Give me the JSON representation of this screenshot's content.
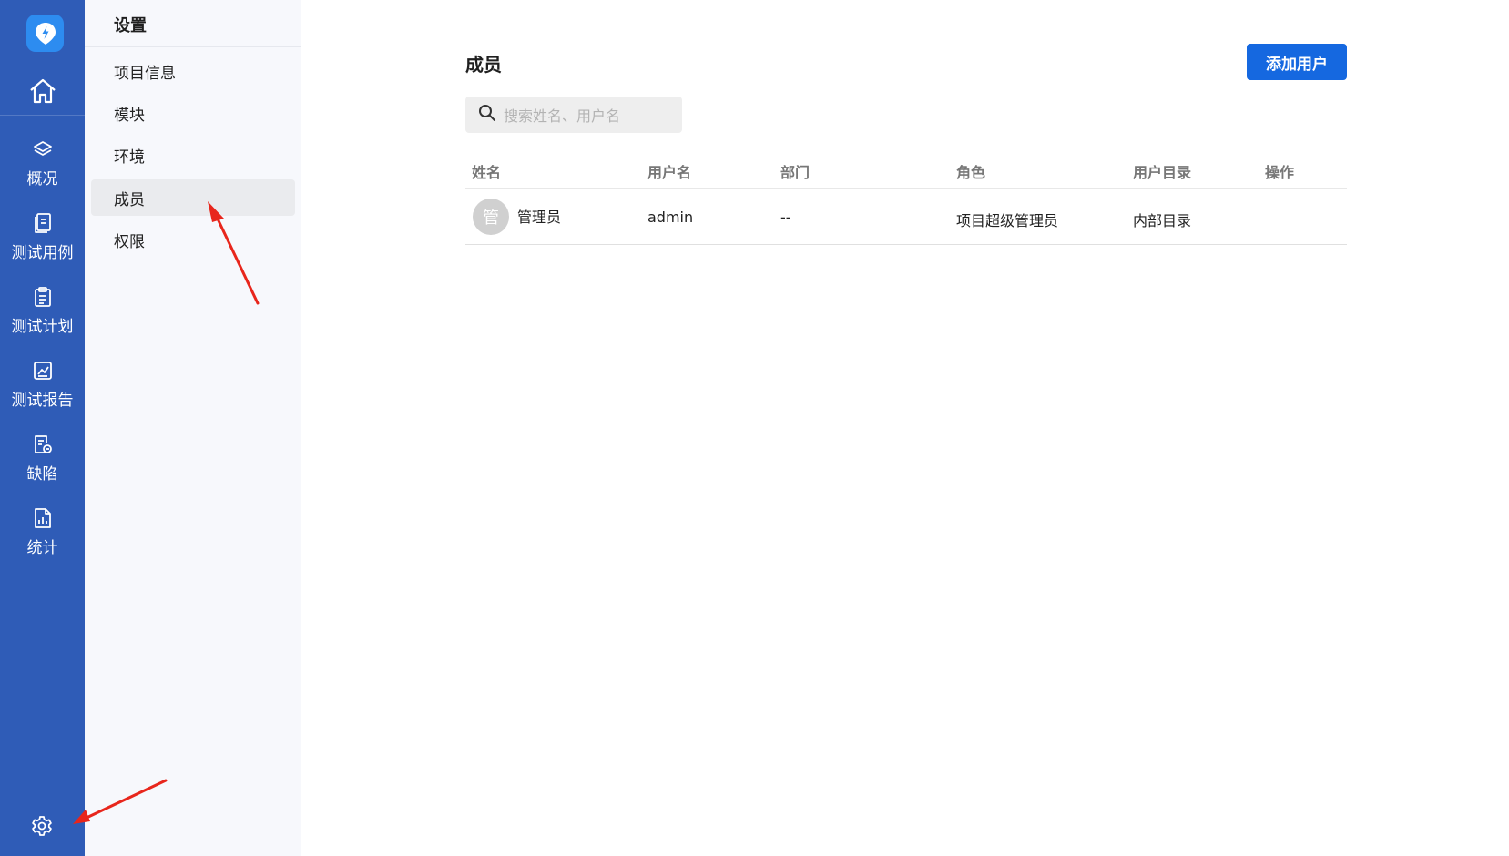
{
  "rail": {
    "items": [
      {
        "icon": "layers-icon",
        "label": "概况"
      },
      {
        "icon": "test-case-icon",
        "label": "测试用例"
      },
      {
        "icon": "clipboard-icon",
        "label": "测试计划"
      },
      {
        "icon": "report-chart-icon",
        "label": "测试报告"
      },
      {
        "icon": "bug-doc-icon",
        "label": "缺陷"
      },
      {
        "icon": "stats-doc-icon",
        "label": "统计"
      }
    ],
    "accent": "#2f5cb7"
  },
  "sidebar": {
    "title": "设置",
    "items": [
      {
        "label": "项目信息"
      },
      {
        "label": "模块"
      },
      {
        "label": "环境"
      },
      {
        "label": "成员",
        "active": true
      },
      {
        "label": "权限"
      }
    ]
  },
  "main": {
    "title": "成员",
    "add_button": "添加用户",
    "search_placeholder": "搜索姓名、用户名",
    "table": {
      "headers": [
        "姓名",
        "用户名",
        "部门",
        "角色",
        "用户目录",
        "操作"
      ],
      "rows": [
        {
          "avatar": "管",
          "name": "管理员",
          "username": "admin",
          "department": "--",
          "role": "项目超级管理员",
          "directory": "内部目录",
          "action": ""
        }
      ]
    }
  },
  "colors": {
    "primary_button": "#1568e0",
    "annotation_arrow": "#e8261c"
  }
}
